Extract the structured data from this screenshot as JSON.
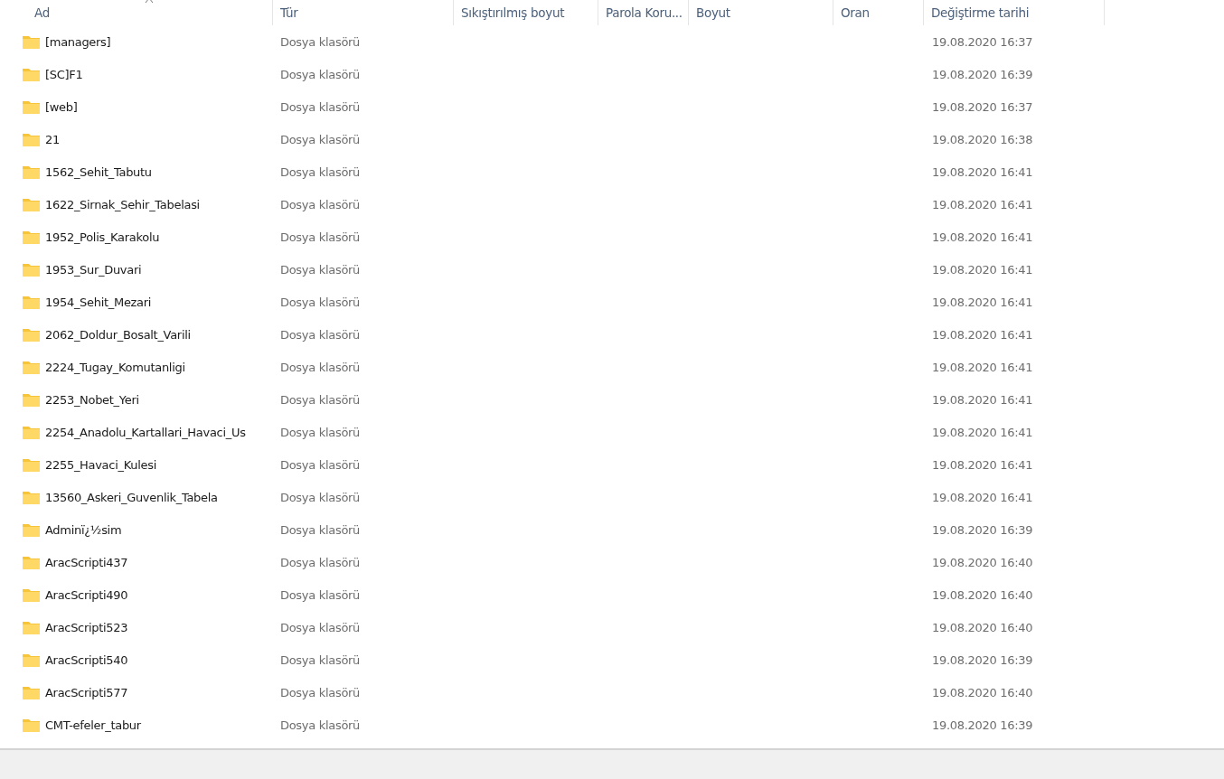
{
  "columns": [
    {
      "label": "Ad",
      "sorted": true
    },
    {
      "label": "Tür",
      "sorted": false
    },
    {
      "label": "Sıkıştırılmış boyut",
      "sorted": false
    },
    {
      "label": "Parola Koru...",
      "sorted": false
    },
    {
      "label": "Boyut",
      "sorted": false
    },
    {
      "label": "Oran",
      "sorted": false
    },
    {
      "label": "Değiştirme tarihi",
      "sorted": false
    }
  ],
  "rows": [
    {
      "name": "[managers]",
      "type": "Dosya klasörü",
      "modified": "19.08.2020 16:37"
    },
    {
      "name": "[SC]F1",
      "type": "Dosya klasörü",
      "modified": "19.08.2020 16:39"
    },
    {
      "name": "[web]",
      "type": "Dosya klasörü",
      "modified": "19.08.2020 16:37"
    },
    {
      "name": "21",
      "type": "Dosya klasörü",
      "modified": "19.08.2020 16:38"
    },
    {
      "name": "1562_Sehit_Tabutu",
      "type": "Dosya klasörü",
      "modified": "19.08.2020 16:41"
    },
    {
      "name": "1622_Sirnak_Sehir_Tabelasi",
      "type": "Dosya klasörü",
      "modified": "19.08.2020 16:41"
    },
    {
      "name": "1952_Polis_Karakolu",
      "type": "Dosya klasörü",
      "modified": "19.08.2020 16:41"
    },
    {
      "name": "1953_Sur_Duvari",
      "type": "Dosya klasörü",
      "modified": "19.08.2020 16:41"
    },
    {
      "name": "1954_Sehit_Mezari",
      "type": "Dosya klasörü",
      "modified": "19.08.2020 16:41"
    },
    {
      "name": "2062_Doldur_Bosalt_Varili",
      "type": "Dosya klasörü",
      "modified": "19.08.2020 16:41"
    },
    {
      "name": "2224_Tugay_Komutanligi",
      "type": "Dosya klasörü",
      "modified": "19.08.2020 16:41"
    },
    {
      "name": "2253_Nobet_Yeri",
      "type": "Dosya klasörü",
      "modified": "19.08.2020 16:41"
    },
    {
      "name": "2254_Anadolu_Kartallari_Havaci_Us",
      "type": "Dosya klasörü",
      "modified": "19.08.2020 16:41"
    },
    {
      "name": "2255_Havaci_Kulesi",
      "type": "Dosya klasörü",
      "modified": "19.08.2020 16:41"
    },
    {
      "name": "13560_Askeri_Guvenlik_Tabela",
      "type": "Dosya klasörü",
      "modified": "19.08.2020 16:41"
    },
    {
      "name": "Adminï¿½sim",
      "type": "Dosya klasörü",
      "modified": "19.08.2020 16:39"
    },
    {
      "name": "AracScripti437",
      "type": "Dosya klasörü",
      "modified": "19.08.2020 16:40"
    },
    {
      "name": "AracScripti490",
      "type": "Dosya klasörü",
      "modified": "19.08.2020 16:40"
    },
    {
      "name": "AracScripti523",
      "type": "Dosya klasörü",
      "modified": "19.08.2020 16:40"
    },
    {
      "name": "AracScripti540",
      "type": "Dosya klasörü",
      "modified": "19.08.2020 16:39"
    },
    {
      "name": "AracScripti577",
      "type": "Dosya klasörü",
      "modified": "19.08.2020 16:40"
    },
    {
      "name": "CMT-efeler_tabur",
      "type": "Dosya klasörü",
      "modified": "19.08.2020 16:39"
    }
  ]
}
